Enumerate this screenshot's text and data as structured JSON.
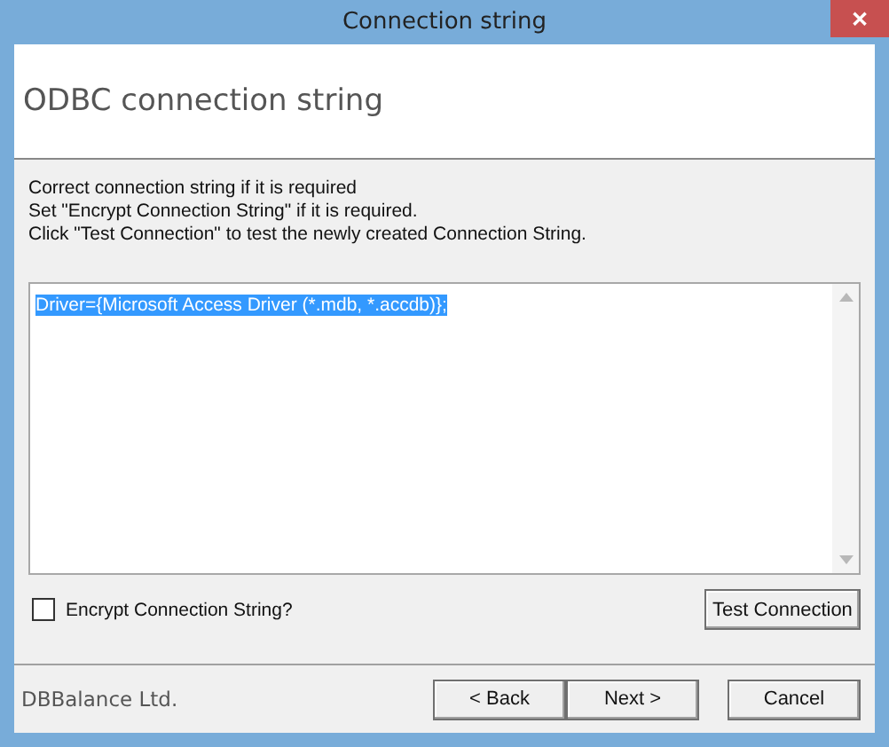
{
  "window": {
    "title": "Connection string",
    "close_icon": "✕"
  },
  "header": {
    "title": "ODBC connection string"
  },
  "instructions": [
    "Correct connection string if it is required",
    "Set \"Encrypt Connection String\" if it is required.",
    "Click \"Test Connection\" to test the newly created Connection String."
  ],
  "connection_string": {
    "value": "Driver={Microsoft Access Driver (*.mdb, *.accdb)};",
    "selected": true
  },
  "encrypt": {
    "label": "Encrypt Connection String?",
    "checked": false
  },
  "test_button": "Test Connection",
  "footer": {
    "company": "DBBalance Ltd.",
    "buttons": [
      "< Back",
      "Next >",
      "Cancel"
    ]
  }
}
